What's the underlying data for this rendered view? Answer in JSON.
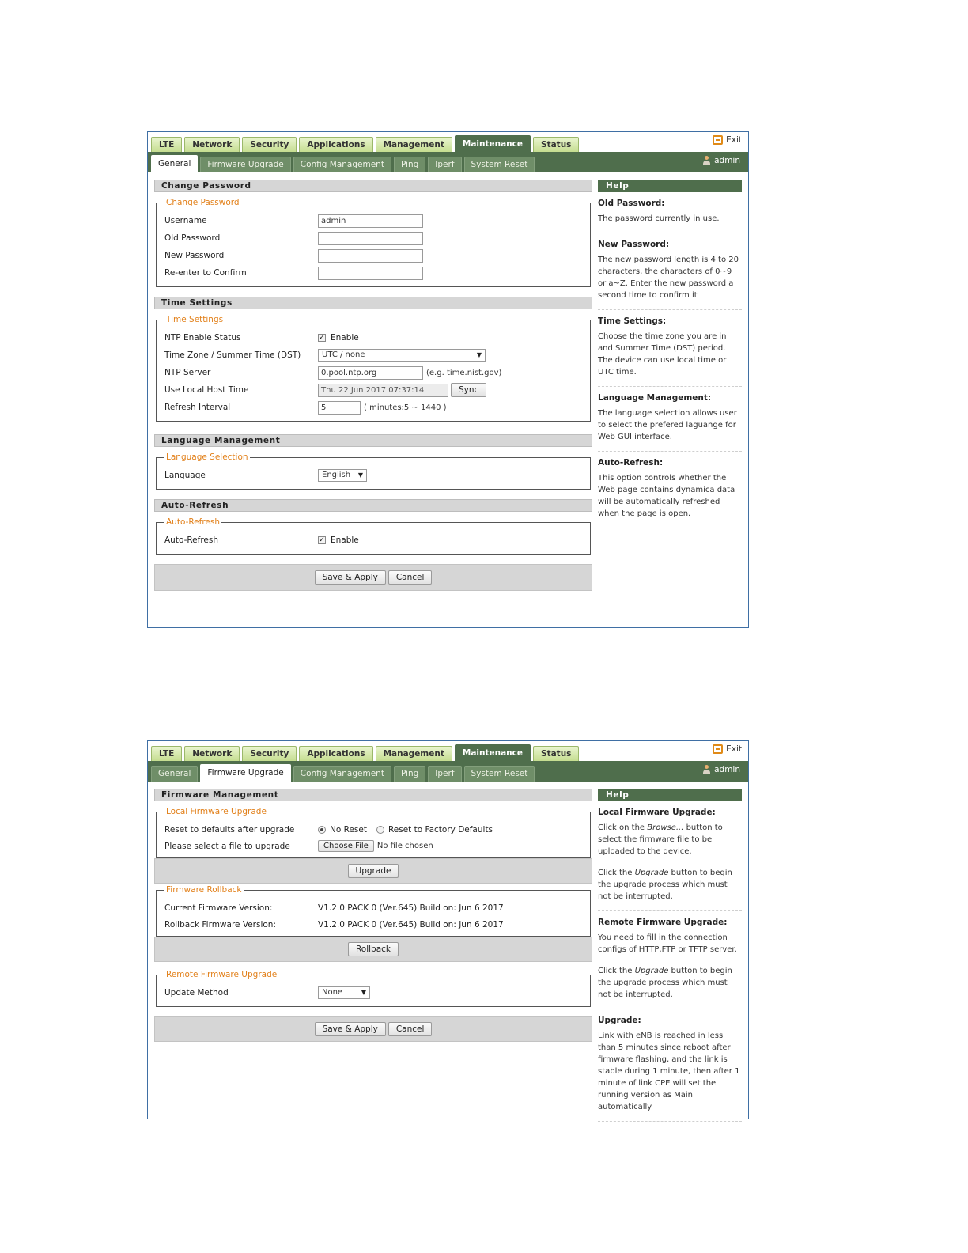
{
  "nav": {
    "main_tabs": [
      "LTE",
      "Network",
      "Security",
      "Applications",
      "Management",
      "Maintenance",
      "Status"
    ],
    "active_main": "Maintenance",
    "sub_tabs": [
      "General",
      "Firmware Upgrade",
      "Config Management",
      "Ping",
      "Iperf",
      "System Reset"
    ],
    "exit_label": "Exit",
    "user_label": "admin"
  },
  "general": {
    "change_password": {
      "heading": "Change Password",
      "legend": "Change Password",
      "username_label": "Username",
      "username_value": "admin",
      "old_password_label": "Old Password",
      "new_password_label": "New Password",
      "confirm_label": "Re-enter to Confirm"
    },
    "time_settings": {
      "heading": "Time Settings",
      "legend": "Time Settings",
      "ntp_status_label": "NTP Enable Status",
      "ntp_enable_label": "Enable",
      "timezone_label": "Time Zone / Summer Time (DST)",
      "timezone_value": "UTC / none",
      "ntp_server_label": "NTP Server",
      "ntp_server_value": "0.pool.ntp.org",
      "ntp_server_hint": "(e.g. time.nist.gov)",
      "local_time_label": "Use Local Host Time",
      "local_time_value": "Thu 22 Jun 2017 07:37:14",
      "sync_label": "Sync",
      "refresh_label": "Refresh Interval",
      "refresh_value": "5",
      "refresh_hint": "( minutes:5 ~ 1440 )"
    },
    "language": {
      "heading": "Language Management",
      "legend": "Language Selection",
      "label": "Language",
      "value": "English"
    },
    "auto_refresh": {
      "heading": "Auto-Refresh",
      "legend": "Auto-Refresh",
      "label": "Auto-Refresh",
      "enable_label": "Enable"
    },
    "save_label": "Save & Apply",
    "cancel_label": "Cancel",
    "help": {
      "heading": "Help",
      "items": [
        {
          "title": "Old Password:",
          "text": "The password currently in use."
        },
        {
          "title": "New Password:",
          "text": "The new password length is 4 to 20 characters, the characters of 0~9 or a~Z. Enter the new password a second time to confirm it"
        },
        {
          "title": "Time Settings:",
          "text": "Choose the time zone you are in and Summer Time (DST) period. The device can use local time or UTC time."
        },
        {
          "title": "Language Management:",
          "text": "The language selection allows user to select the prefered laguange for Web GUI interface."
        },
        {
          "title": "Auto-Refresh:",
          "text": "This option controls whether the Web page contains dynamica data will be automatically refreshed when the page is open."
        }
      ]
    }
  },
  "firmware": {
    "heading": "Firmware Management",
    "local": {
      "legend": "Local Firmware Upgrade",
      "reset_label": "Reset to defaults after upgrade",
      "no_reset_label": "No Reset",
      "factory_label": "Reset to Factory Defaults",
      "file_label": "Please select a file to upgrade",
      "choose_file_label": "Choose File",
      "no_file_label": "No file chosen",
      "upgrade_label": "Upgrade"
    },
    "rollback": {
      "legend": "Firmware Rollback",
      "current_label": "Current Firmware Version:",
      "current_value": "V1.2.0 PACK 0 (Ver.645) Build on: Jun 6 2017",
      "rollback_label": "Rollback Firmware Version:",
      "rollback_value": "V1.2.0 PACK 0 (Ver.645) Build on: Jun 6 2017",
      "button_label": "Rollback"
    },
    "remote": {
      "legend": "Remote Firmware Upgrade",
      "method_label": "Update Method",
      "method_value": "None"
    },
    "save_label": "Save & Apply",
    "cancel_label": "Cancel",
    "help": {
      "heading": "Help",
      "local_title": "Local Firmware Upgrade:",
      "local_text1_a": "Click on the ",
      "local_text1_em": "Browse...",
      "local_text1_b": " button to select the firmware file to be uploaded to the device.",
      "local_text2_a": "Click the ",
      "local_text2_em": "Upgrade",
      "local_text2_b": " button to begin the upgrade process which must not be interrupted.",
      "remote_title": "Remote Firmware Upgrade:",
      "remote_text1": "You need to fill in the connection configs of HTTP,FTP or TFTP server.",
      "remote_text2_a": "Click the ",
      "remote_text2_em": "Upgrade",
      "remote_text2_b": " button to begin the upgrade process which must not be interrupted.",
      "upgrade_title": "Upgrade:",
      "upgrade_text": "Link with eNB is reached in less than 5 minutes since reboot after firmware flashing, and the link is stable during 1 minute, then after 1 minute of link CPE will set the running version as Main automatically"
    }
  }
}
